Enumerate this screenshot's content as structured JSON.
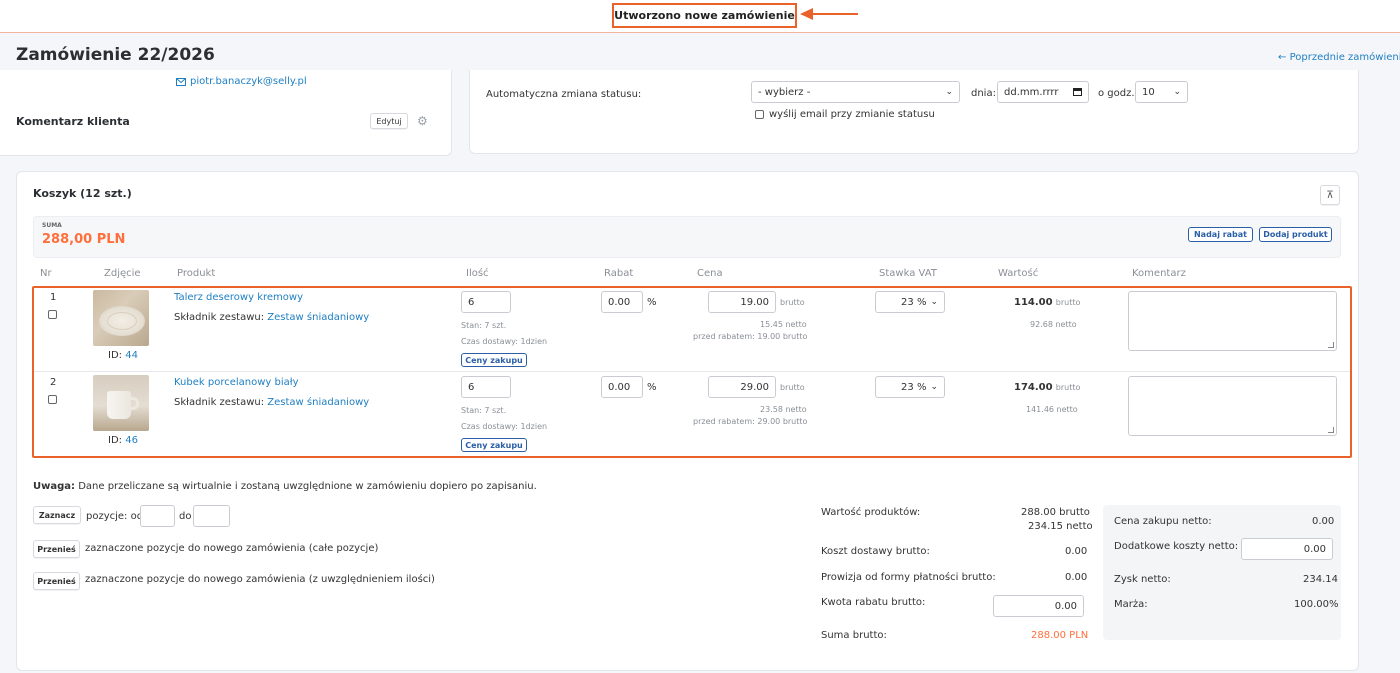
{
  "notification": {
    "text": "Utworzono nowe zamówienie"
  },
  "header": {
    "title": "Zamówienie 22/2026",
    "prev_link": "Poprzednie zamówienie"
  },
  "customer": {
    "email": "piotr.banaczyk@selly.pl",
    "comment_title": "Komentarz klienta",
    "edit_button": "Edytuj"
  },
  "status": {
    "auto_change_label": "Automatyczna zmiana statusu:",
    "select_value": "- wybierz -",
    "day_label": "dnia:",
    "date_placeholder": "dd.mm.rrrr",
    "hour_label": "o godz.",
    "hour_value": "10",
    "email_checkbox_label": "wyślij email przy zmianie statusu"
  },
  "cart": {
    "title": "Koszyk (12 szt.)",
    "sum_label": "SUMA",
    "sum_value": "288,00 PLN",
    "discount_button": "Nadaj rabat",
    "add_product_button": "Dodaj produkt",
    "columns": [
      "Nr",
      "Zdjęcie",
      "Produkt",
      "Ilość",
      "Rabat",
      "Cena",
      "Stawka VAT",
      "Wartość",
      "Komentarz"
    ],
    "items": [
      {
        "nr": "1",
        "id_label": "ID:",
        "id": "44",
        "name": "Talerz deserowy kremowy",
        "set_label": "Składnik zestawu:",
        "set_name": "Zestaw śniadaniowy",
        "qty": "6",
        "stock": "Stan: 7 szt.",
        "delivery": "Czas dostawy: 1dzien",
        "purchase_button": "Ceny zakupu",
        "discount": "0.00",
        "discount_unit": "%",
        "price": "19.00",
        "price_type": "brutto",
        "net": "15.45 netto",
        "before_discount": "przed rabatem: 19.00 brutto",
        "vat": "23 %",
        "value": "114.00",
        "value_type": "brutto",
        "value_net": "92.68 netto"
      },
      {
        "nr": "2",
        "id_label": "ID:",
        "id": "46",
        "name": "Kubek porcelanowy biały",
        "set_label": "Składnik zestawu:",
        "set_name": "Zestaw śniadaniowy",
        "qty": "6",
        "stock": "Stan: 7 szt.",
        "delivery": "Czas dostawy: 1dzien",
        "purchase_button": "Ceny zakupu",
        "discount": "0.00",
        "discount_unit": "%",
        "price": "29.00",
        "price_type": "brutto",
        "net": "23.58 netto",
        "before_discount": "przed rabatem: 29.00 brutto",
        "vat": "23 %",
        "value": "174.00",
        "value_type": "brutto",
        "value_net": "141.46 netto"
      }
    ]
  },
  "footer": {
    "note_bold": "Uwaga:",
    "note_text": "Dane przeliczane są wirtualnie i zostaną uwzględnione w zamówieniu dopiero po zapisaniu.",
    "select_button": "Zaznacz",
    "positions_from": "pozycje: od",
    "positions_to": "do",
    "move_button": "Przenieś",
    "move_all_text": "zaznaczone pozycje do nowego zamówienia (całe pozycje)",
    "move_qty_text": "zaznaczone pozycje do nowego zamówienia (z uwzględnieniem ilości)"
  },
  "totals": {
    "products_label": "Wartość produktów:",
    "products_gross": "288.00 brutto",
    "products_net": "234.15 netto",
    "shipping_label": "Koszt dostawy brutto:",
    "shipping_value": "0.00",
    "commission_label": "Prowizja od formy płatności brutto:",
    "commission_value": "0.00",
    "discount_label": "Kwota rabatu brutto:",
    "discount_value": "0.00",
    "sum_label": "Suma brutto:",
    "sum_value": "288.00 PLN"
  },
  "profit": {
    "purchase_label": "Cena zakupu netto:",
    "purchase_value": "0.00",
    "extra_label": "Dodatkowe koszty netto:",
    "extra_value": "0.00",
    "profit_label": "Zysk netto:",
    "profit_value": "234.14",
    "margin_label": "Marża:",
    "margin_value": "100.00%"
  },
  "colors": {
    "accent": "#ff6f3c",
    "highlight_border": "#e8622a",
    "link": "#1f7fc2",
    "button_blue": "#2a5fa8"
  }
}
